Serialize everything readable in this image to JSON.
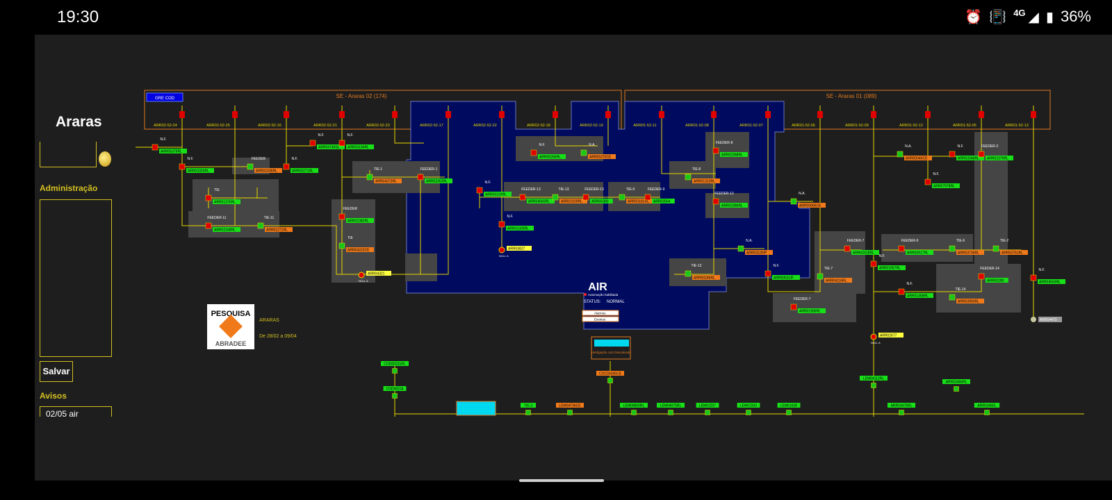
{
  "status_bar": {
    "time": "19:30",
    "network": "4G",
    "battery": "36%",
    "icons": [
      "alarm-icon",
      "vibrate-icon",
      "signal-icon",
      "battery-icon"
    ]
  },
  "sidebar": {
    "title": "Araras",
    "admin_label": "Administração",
    "save_label": "Salvar",
    "avisos_label": "Avisos",
    "aviso_item": "02/05  air"
  },
  "header": {
    "gre_button": "GRE COD",
    "substation_2": "SE - Araras 02  (174)",
    "substation_1": "SE - Araras 01  (089)",
    "breakers": [
      "ARR02-52-24",
      "ARR02-52-25",
      "ARR02-52-16",
      "ARR02-52-21",
      "ARR02-52-23",
      "ARR02-52-17",
      "ARR02-52-22",
      "ARR02-52-18",
      "ARR02-52-19",
      "ARR01-52-11",
      "ARR01-52-08",
      "ARR01-52-07",
      "ARR01-52-06",
      "ARR01-52-09",
      "ARR01-52-12",
      "ARR01-52-05",
      "ARR01-52-13"
    ]
  },
  "air_panel": {
    "title": "AIR",
    "subtitle": "Automação habilitada",
    "status_label": "STATUS:",
    "status_value": "NORMAL",
    "btn1": "Alarmes",
    "btn2": "Eventos"
  },
  "promo": {
    "badge_top": "PESQUISA",
    "badge_bottom": "ABRADEE",
    "city": "ARARAS",
    "dates": "De 28/02 a 09/04"
  },
  "legend_box": {
    "title": "",
    "text": "Interligação com Descalvado"
  },
  "colors": {
    "accent": "#d4c020",
    "panel": "#000a5e",
    "closed": "#e00000",
    "open": "#18c818",
    "bus": "#e8d800",
    "header_orange": "#e07a20",
    "label_green": "#18e018",
    "label_orange": "#f07a1a"
  },
  "diagram": {
    "switches": [
      {
        "state": "N.F.",
        "id": "ARR05379RL",
        "status": "closed"
      },
      {
        "state": "N.F.",
        "id": "ARR03324RL",
        "status": "closed"
      },
      {
        "state": "FEEDER",
        "id": "ARR02336RL",
        "status": "open"
      },
      {
        "state": "N.F.",
        "id": "ARR05271RL",
        "status": "closed"
      },
      {
        "state": "N.F.",
        "id": "ARR04749SL",
        "status": "closed"
      },
      {
        "state": "N.F.",
        "id": "ARR03194RL",
        "status": "closed"
      },
      {
        "state": "TIE",
        "id": "ARR01376RL",
        "status": "closed"
      },
      {
        "state": "TIE-1",
        "id": "ARR04373RL",
        "status": "open"
      },
      {
        "state": "FEEDER-1",
        "id": "ARR03263RL",
        "status": "closed"
      },
      {
        "state": "FEEDER",
        "id": "ARR02382RL",
        "status": "closed"
      },
      {
        "state": "TIE",
        "id": "ARR04310CE",
        "status": "open"
      },
      {
        "state": "FEEDER-11",
        "id": "ARR02168RL",
        "status": "closed"
      },
      {
        "state": "TIE-11",
        "id": "ARR01271RL",
        "status": "open"
      },
      {
        "state": "N.F.",
        "id": "ARR05310RL",
        "status": "closed"
      },
      {
        "state": "FEEDER-13",
        "id": "ARR04560RL",
        "status": "closed"
      },
      {
        "state": "TIE-13",
        "id": "ARR01029RL",
        "status": "open"
      },
      {
        "state": "FEEDER-13",
        "id": "ARR05380",
        "status": "closed"
      },
      {
        "state": "TIE-9",
        "id": "ARR03181RL",
        "status": "open"
      },
      {
        "state": "FEEDER-9",
        "id": "ARR03564",
        "status": "closed"
      },
      {
        "state": "N.F.",
        "id": "ARR01026RL",
        "status": "closed"
      },
      {
        "state": "N.F.",
        "id": "ARR05266RL",
        "status": "closed"
      },
      {
        "state": "N.A.",
        "id": "ARR05370CE",
        "status": "open"
      },
      {
        "state": "FEEDER-8",
        "id": "ARR02368RL",
        "status": "closed"
      },
      {
        "state": "TIE-8",
        "id": "ARR01313RL",
        "status": "open"
      },
      {
        "state": "FEEDER-12",
        "id": "ARR02386RL",
        "status": "closed"
      },
      {
        "state": "N.A.",
        "id": "ARR00065CE",
        "status": "open"
      },
      {
        "state": "N.A.",
        "id": "ARR03100IP",
        "status": "open"
      },
      {
        "state": "TIE-12",
        "id": "ARR00246RL",
        "status": "open"
      },
      {
        "state": "N.F.",
        "id": "ARR00631IF",
        "status": "closed"
      },
      {
        "state": "FEEDER-7",
        "id": "ARR01905RL",
        "status": "closed"
      },
      {
        "state": "TIE-7",
        "id": "ARR04116RL",
        "status": "open"
      },
      {
        "state": "FEEDER-7",
        "id": "ARR02618RL",
        "status": "closed"
      },
      {
        "state": "N.A.",
        "id": "ARR00046CE",
        "status": "open"
      },
      {
        "state": "N.F.",
        "id": "ARR03348RL",
        "status": "closed"
      },
      {
        "state": "N.F.",
        "id": "ARR07978RL",
        "status": "closed"
      },
      {
        "state": "FEEDER-2",
        "id": "ARR02379RL",
        "status": "closed"
      },
      {
        "state": "FEEDER-6",
        "id": "ARR00917RL",
        "status": "closed"
      },
      {
        "state": "TIE-6",
        "id": "ARR03736RL",
        "status": "open"
      },
      {
        "state": "TIE-2",
        "id": "ARR03761RL",
        "status": "open"
      },
      {
        "state": "FEEDER-14",
        "id": "ARR00280",
        "status": "closed"
      },
      {
        "state": "TIE-14",
        "id": "ARR03950RL",
        "status": "open"
      },
      {
        "state": "N.F.",
        "id": "ARR04559RL",
        "status": "closed"
      },
      {
        "state": "N.F.",
        "id": "ARR01957RL",
        "status": "closed"
      },
      {
        "state": "N.F.",
        "id": "ARR01458RL",
        "status": "closed"
      }
    ],
    "red_tags": [
      "ARR03827",
      "ARR04321",
      "ARR02677"
    ],
    "grey_tag": "ARR04473",
    "bottom_labels": [
      "COD00231RL",
      "COD00234",
      "COC03335CE",
      "TIE-3",
      "LEM04736CE",
      "LEM00800RL",
      "LEM04075RL",
      "LEM02207",
      "LEM02333",
      "LEM01628",
      "LEM04112RL",
      "ARR03476RL",
      "ARR03466RL",
      "ARR03455L",
      "ARR04507CE"
    ],
    "null_label": "NULL A"
  }
}
